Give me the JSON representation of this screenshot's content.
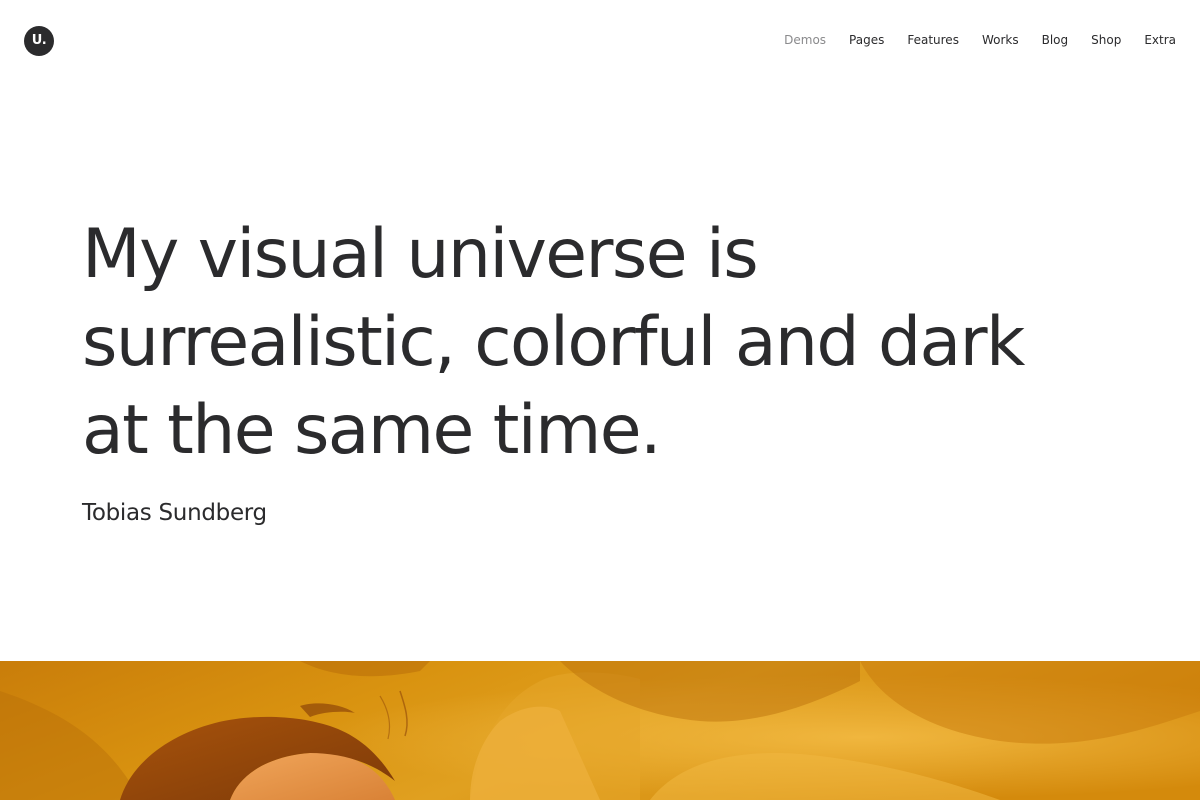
{
  "header": {
    "logo_text": "U.",
    "nav": [
      {
        "label": "Demos",
        "state": "muted"
      },
      {
        "label": "Pages"
      },
      {
        "label": "Features"
      },
      {
        "label": "Works"
      },
      {
        "label": "Blog"
      },
      {
        "label": "Shop"
      },
      {
        "label": "Extra"
      }
    ]
  },
  "hero": {
    "heading_lines": [
      "My visual universe is",
      "surrealistic, colorful and dark",
      "at the same time."
    ],
    "author": "Tobias Sundberg"
  },
  "colors": {
    "text": "#2b2b2d",
    "muted_nav": "#8a8a8c",
    "background": "#ffffff",
    "photo_base": "#d9920f",
    "photo_highlight": "#f2b53a",
    "photo_shadow": "#9c5a08"
  }
}
